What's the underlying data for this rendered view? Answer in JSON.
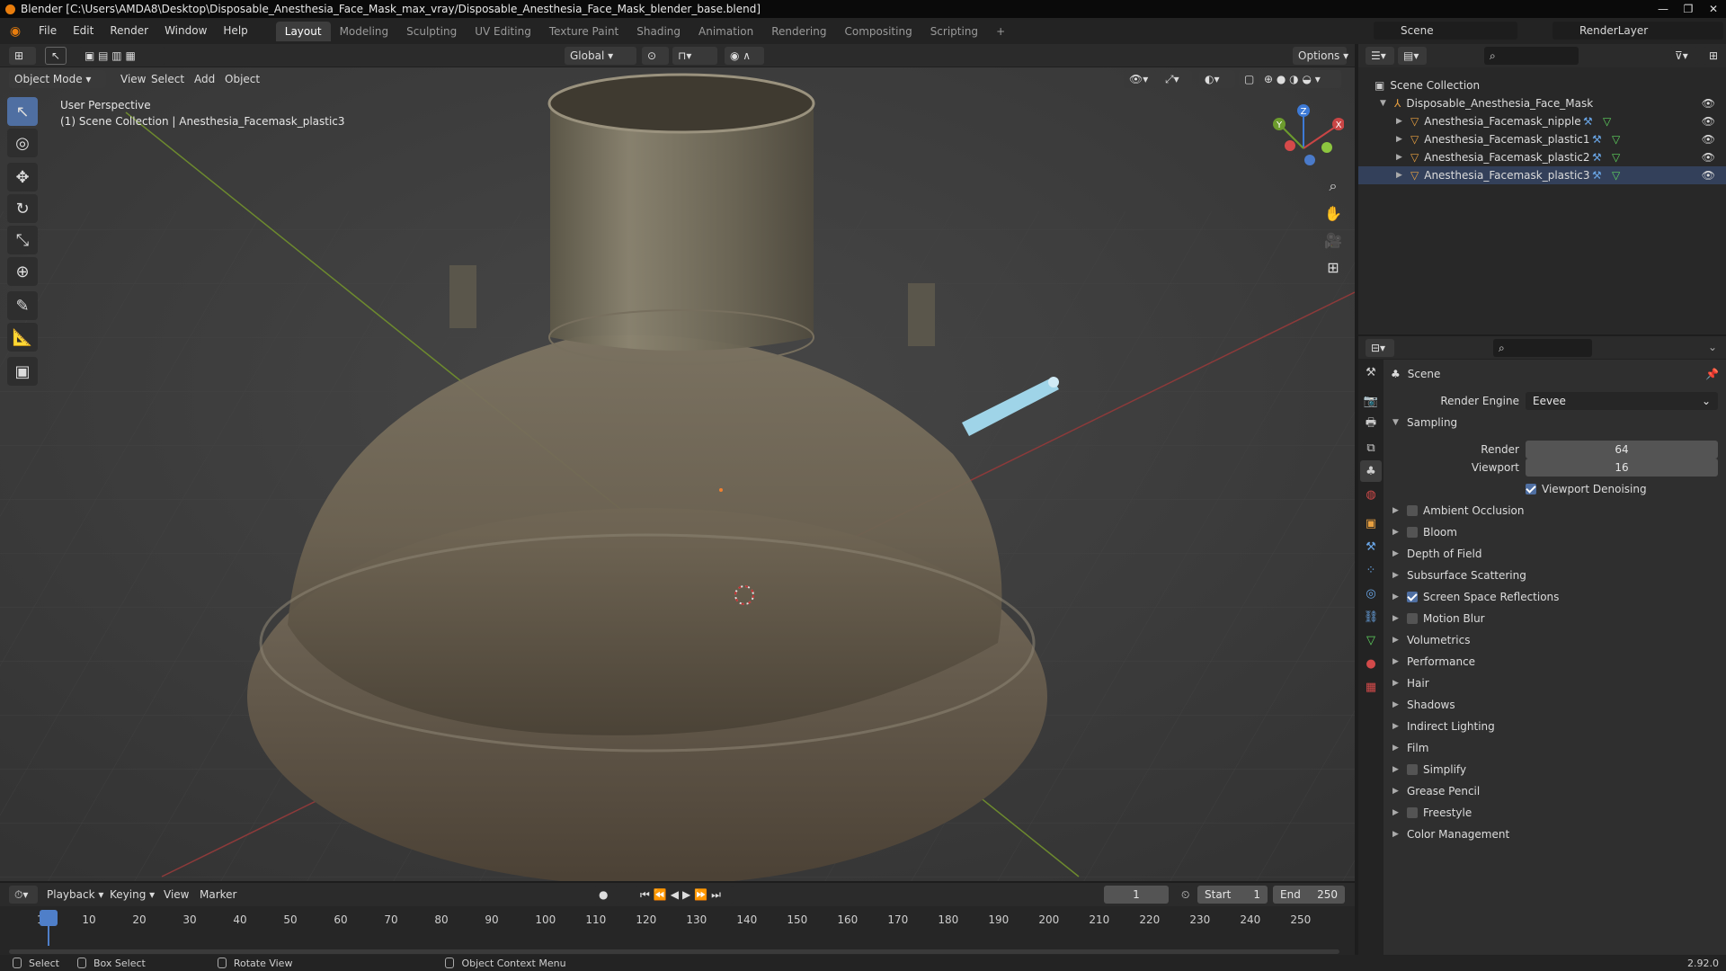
{
  "window": {
    "title": "Blender [C:\\Users\\AMDA8\\Desktop\\Disposable_Anesthesia_Face_Mask_max_vray/Disposable_Anesthesia_Face_Mask_blender_base.blend]"
  },
  "menu": [
    "File",
    "Edit",
    "Render",
    "Window",
    "Help"
  ],
  "workspaces": [
    "Layout",
    "Modeling",
    "Sculpting",
    "UV Editing",
    "Texture Paint",
    "Shading",
    "Animation",
    "Rendering",
    "Compositing",
    "Scripting"
  ],
  "scene_selector": {
    "scene": "Scene",
    "render_layer": "RenderLayer"
  },
  "tool_header": {
    "transform_orientation": "Global",
    "options": "Options"
  },
  "viewport_header": {
    "mode": "Object Mode",
    "menus": [
      "View",
      "Select",
      "Add",
      "Object"
    ]
  },
  "viewport_overlay": {
    "perspective": "User Perspective",
    "context": "(1) Scene Collection | Anesthesia_Facemask_plastic3"
  },
  "gizmo": {
    "x": "X",
    "y": "Y",
    "z": "Z"
  },
  "outliner": {
    "root": "Scene Collection",
    "collection": "Disposable_Anesthesia_Face_Mask",
    "objects": [
      "Anesthesia_Facemask_nipple",
      "Anesthesia_Facemask_plastic1",
      "Anesthesia_Facemask_plastic2",
      "Anesthesia_Facemask_plastic3"
    ]
  },
  "properties": {
    "context": "Scene",
    "render_engine_label": "Render Engine",
    "render_engine": "Eevee",
    "sampling": {
      "label": "Sampling",
      "render_label": "Render",
      "render": "64",
      "viewport_label": "Viewport",
      "viewport": "16",
      "denoise": "Viewport Denoising"
    },
    "panels": [
      {
        "label": "Ambient Occlusion",
        "checkbox": true,
        "checked": false
      },
      {
        "label": "Bloom",
        "checkbox": true,
        "checked": false
      },
      {
        "label": "Depth of Field",
        "checkbox": false
      },
      {
        "label": "Subsurface Scattering",
        "checkbox": false
      },
      {
        "label": "Screen Space Reflections",
        "checkbox": true,
        "checked": true
      },
      {
        "label": "Motion Blur",
        "checkbox": true,
        "checked": false
      },
      {
        "label": "Volumetrics",
        "checkbox": false
      },
      {
        "label": "Performance",
        "checkbox": false
      },
      {
        "label": "Hair",
        "checkbox": false
      },
      {
        "label": "Shadows",
        "checkbox": false
      },
      {
        "label": "Indirect Lighting",
        "checkbox": false
      },
      {
        "label": "Film",
        "checkbox": false
      },
      {
        "label": "Simplify",
        "checkbox": true,
        "checked": false
      },
      {
        "label": "Grease Pencil",
        "checkbox": false
      },
      {
        "label": "Freestyle",
        "checkbox": true,
        "checked": false
      },
      {
        "label": "Color Management",
        "checkbox": false
      }
    ]
  },
  "timeline": {
    "menus": [
      "Playback",
      "Keying",
      "View",
      "Marker"
    ],
    "current_frame": "1",
    "start_label": "Start",
    "start": "1",
    "end_label": "End",
    "end": "250",
    "ticks": [
      "1",
      "10",
      "20",
      "30",
      "40",
      "50",
      "60",
      "70",
      "80",
      "90",
      "100",
      "110",
      "120",
      "130",
      "140",
      "150",
      "160",
      "170",
      "180",
      "190",
      "200",
      "210",
      "220",
      "230",
      "240",
      "250"
    ]
  },
  "statusbar": {
    "items": [
      "Select",
      "Box Select",
      "Rotate View",
      "Object Context Menu"
    ],
    "version": "2.92.0"
  }
}
